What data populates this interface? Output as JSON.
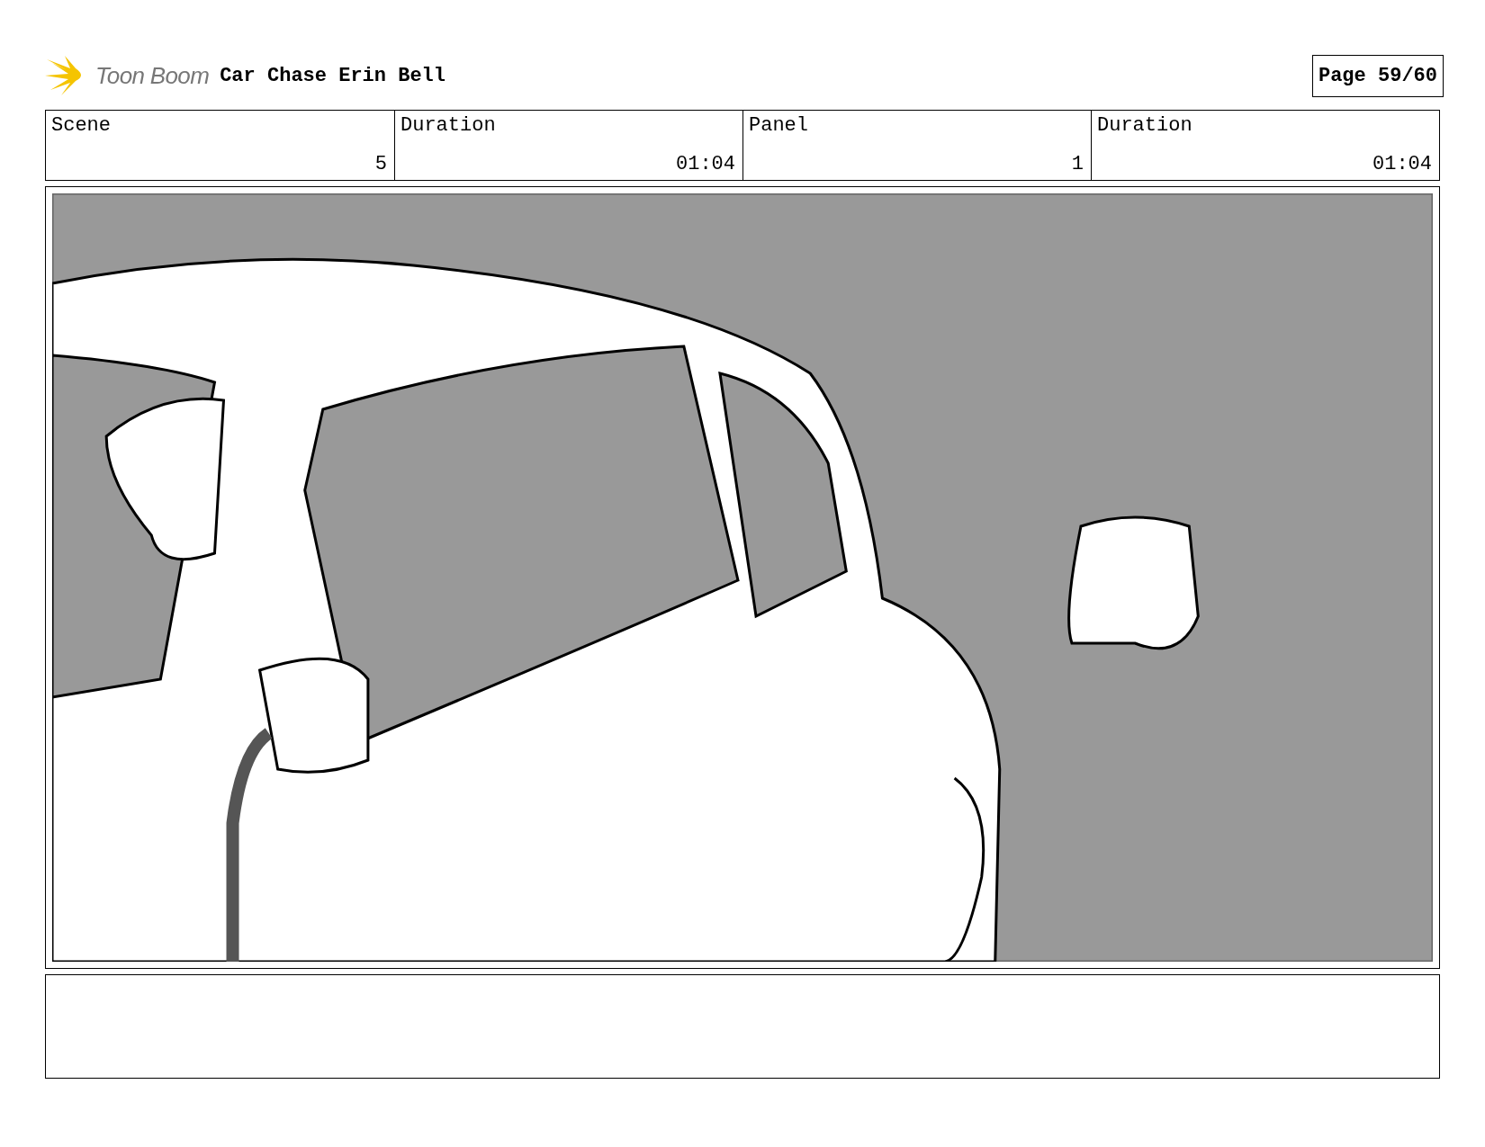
{
  "header": {
    "logo_text": "Toon Boom",
    "title": "Car Chase Erin Bell",
    "page": "Page 59/60"
  },
  "info_table": {
    "columns": [
      "Scene",
      "Duration",
      "Panel",
      "Duration"
    ],
    "rows": [
      [
        "5",
        "01:04",
        "1",
        "01:04"
      ]
    ]
  }
}
